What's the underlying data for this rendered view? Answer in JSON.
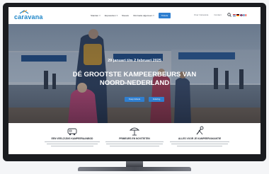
{
  "logo": {
    "text": "caravana"
  },
  "nav": {
    "items": [
      {
        "label": "Standen",
        "caret": "▾"
      },
      {
        "label": "Exposanten",
        "caret": "▾"
      },
      {
        "label": "Nieuws",
        "caret": ""
      },
      {
        "label": "Informatie algemeen",
        "caret": "▾"
      }
    ],
    "cta": "Tickets",
    "utility": [
      "Over Caravana",
      "Contact"
    ],
    "search_icon": "search-icon",
    "flags": [
      "nl-flag",
      "de-flag",
      "en-flag",
      "fr-flag"
    ]
  },
  "hero": {
    "date": "29 januari t/m 2 februari 2025",
    "title": "DÉ GROOTSTE KAMPEERBEURS VAN NOORD-NEDERLAND",
    "buttons": [
      "Koop tickets",
      "Indeling"
    ]
  },
  "features": [
    {
      "icon": "camper-icon",
      "title": "EEN VEELZIJDIG KAMPEERAANBOD"
    },
    {
      "icon": "parasol-icon",
      "title": "PRIMEURS EN NOVITEITEN"
    },
    {
      "icon": "tools-icon",
      "title": "ALLES VOOR JE KAMPEERVAKANTIE"
    }
  ],
  "colors": {
    "brand": "#1f86c8",
    "button": "#2f7fd0"
  }
}
